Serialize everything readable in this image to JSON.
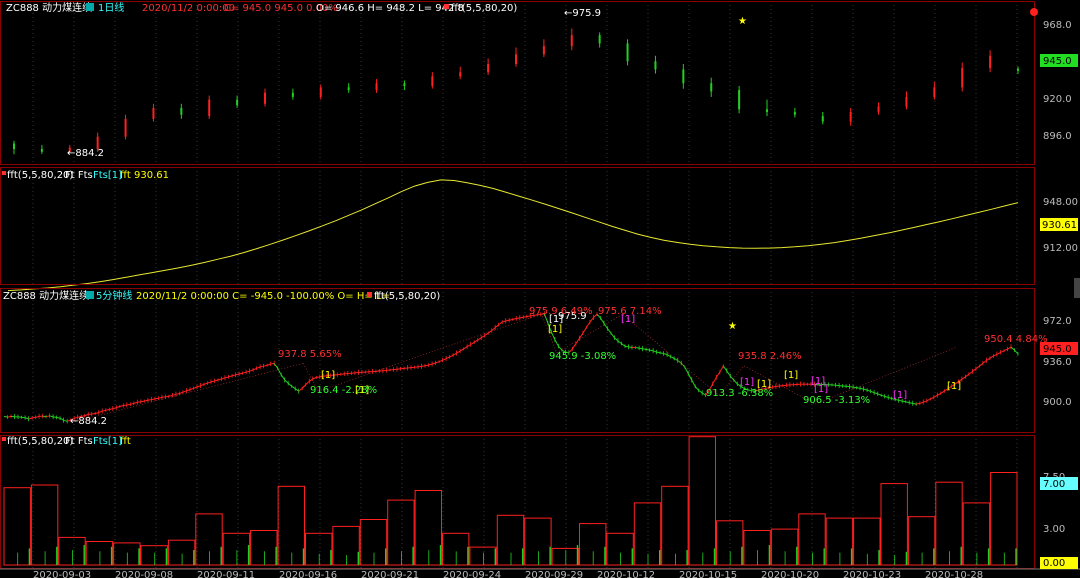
{
  "colors": {
    "background": "#000000",
    "panel_border": "#8b0000",
    "grid": "#555555",
    "up": "#ff2020",
    "down": "#22d022",
    "ma_line": "#e8e830",
    "price_box": "#22dd22",
    "price_box_red": "#ff2020",
    "fft_box": "#66ffff",
    "zero_box": "#ffff00",
    "label_white": "#ffffff",
    "label_green": "#33ff33",
    "label_red": "#ff3030",
    "label_yellow": "#ffff00",
    "label_magenta": "#ff33ff",
    "header_cyan": "#33ffff"
  },
  "panel1": {
    "symbol": "ZC888 动力煤连续",
    "period": "1日线",
    "datetime": "2020/11/2 0:00:00",
    "quote": "C= 945.0  945.0  0.00%",
    "ohlc": "O= 946.6  H= 948.2  L= 942.8",
    "indicator": "fft(5,5,80,20)",
    "hi_label": "←975.9",
    "lo_label": "←884.2",
    "price_tag": "945.0",
    "yticks": [
      "968.0",
      "920.0",
      "896.0"
    ],
    "star_icon": "★"
  },
  "panel2": {
    "title": "fft(5,5,80,20)",
    "items": "Ft Fts",
    "fts": "Fts[1]",
    "fft_value": "fft 930.61",
    "value_tag": "930.61",
    "yticks": [
      "948.00",
      "912.00"
    ]
  },
  "panel3": {
    "symbol": "ZC888 动力煤连续",
    "period": "5分钟线",
    "quote": "2020/11/2 0:00:00 C=  -945.0 -100.00% O= H= L=",
    "indicator": "fft(5,5,80,20)",
    "hi_label": "975.9",
    "lo_label": "←884.2",
    "price_tag": "945.0",
    "yticks": [
      "972.0",
      "936.0",
      "900.0"
    ],
    "star_icon": "★",
    "annotations_red": [
      "975.9 6.49%",
      "975.6 7.14%",
      "937.8 5.65%",
      "935.8 2.46%",
      "950.4 4.84%"
    ],
    "annotations_green": [
      "945.9 -3.08%",
      "916.4 -2.28%",
      "913.3 -6.38%",
      "906.5 -3.13%"
    ],
    "markers": [
      "[1]",
      "[1]",
      "[1]",
      "[1]",
      "[1]",
      "[1]",
      "[1]",
      "[1]",
      "[1]",
      "[1]",
      "[1]",
      "[1]"
    ]
  },
  "panel4": {
    "title": "fft(5,5,80,20)",
    "items": "Ft Fts",
    "fts": "Fts[1]",
    "fft_label": "fft",
    "value_tag": "7.00",
    "zero_tag": "0.00",
    "yticks": [
      "7.50",
      "3.00"
    ]
  },
  "x_axis": {
    "dates": [
      "2020-09-03",
      "2020-09-08",
      "2020-09-11",
      "2020-09-16",
      "2020-09-21",
      "2020-09-24",
      "2020-09-29",
      "2020-10-12",
      "2020-10-15",
      "2020-10-20",
      "2020-10-23",
      "2020-10-28"
    ]
  },
  "chart_data": [
    {
      "type": "candlestick",
      "title": "ZC888 动力煤连续 1日线",
      "ylim": [
        880,
        985
      ],
      "x": [
        "2020-09-03",
        "2020-09-04",
        "2020-09-07",
        "2020-09-08",
        "2020-09-09",
        "2020-09-10",
        "2020-09-11",
        "2020-09-14",
        "2020-09-15",
        "2020-09-16",
        "2020-09-17",
        "2020-09-18",
        "2020-09-21",
        "2020-09-22",
        "2020-09-23",
        "2020-09-24",
        "2020-09-25",
        "2020-09-28",
        "2020-09-29",
        "2020-09-30",
        "2020-10-09",
        "2020-10-12",
        "2020-10-13",
        "2020-10-14",
        "2020-10-15",
        "2020-10-16",
        "2020-10-19",
        "2020-10-20",
        "2020-10-21",
        "2020-10-22",
        "2020-10-23",
        "2020-10-26",
        "2020-10-27",
        "2020-10-28",
        "2020-10-29",
        "2020-10-30",
        "2020-11-02"
      ],
      "open": [
        892,
        888,
        886,
        888,
        897,
        910,
        918,
        912,
        924,
        921,
        929,
        926,
        933,
        931,
        936,
        934,
        941,
        944,
        950,
        957,
        963,
        971,
        965,
        952,
        946,
        936,
        931,
        917,
        915,
        912,
        908,
        915,
        919,
        926,
        933,
        947,
        946.6
      ],
      "close": [
        888,
        886,
        889,
        897,
        910,
        918,
        913,
        924,
        920,
        929,
        926,
        933,
        931,
        936,
        934,
        941,
        944,
        950,
        957,
        963,
        971,
        965,
        952,
        946,
        936,
        930,
        917,
        915,
        913,
        908,
        915,
        919,
        926,
        933,
        947,
        956,
        945.0
      ],
      "high": [
        894,
        891,
        891,
        900,
        913,
        921,
        921,
        927,
        927,
        932,
        932,
        935,
        936,
        939,
        938,
        944,
        948,
        954,
        962,
        968,
        975.9,
        973,
        968,
        956,
        950,
        940,
        934,
        924,
        918,
        915,
        918,
        922,
        930,
        937,
        951,
        960,
        948.2
      ],
      "low": [
        884.2,
        884.5,
        885,
        886,
        895,
        908,
        910,
        910,
        918,
        919,
        924,
        924,
        929,
        929,
        931,
        932,
        939,
        942,
        948,
        955,
        960,
        962,
        949,
        943,
        932,
        926,
        914,
        912,
        911,
        906,
        905,
        913,
        917,
        924,
        930,
        944,
        942.8
      ]
    },
    {
      "type": "line",
      "title": "fft(5,5,80,20)",
      "ylim": [
        895,
        965
      ],
      "series": [
        {
          "name": "fft",
          "values": [
            889.5,
            890,
            890.6,
            891.2,
            892,
            893,
            894,
            895.2,
            896.5,
            898,
            899.5,
            901,
            902.5,
            904,
            905.7,
            907.5,
            909.5,
            911.5,
            913.8,
            916.3,
            919,
            921.8,
            924.7,
            927.7,
            930.8,
            934,
            937.5,
            941,
            944.8,
            948.6,
            952.5,
            956,
            958.4,
            960,
            959.6,
            958.2,
            956.5,
            954.5,
            952,
            949.5,
            947,
            944.4,
            941.7,
            939,
            936.2,
            933.4,
            930.6,
            928,
            925.5,
            923.4,
            921.6,
            920.2,
            919,
            918.1,
            917.4,
            916.9,
            916.6,
            916.5,
            916.6,
            916.9,
            917.4,
            918.1,
            919,
            920.1,
            921.4,
            922.8,
            924.4,
            926,
            927.8,
            929.6,
            931.5,
            933.4,
            935.3,
            937.3,
            939.3,
            941.3,
            943.4,
            945.5
          ]
        }
      ]
    },
    {
      "type": "line",
      "title": "ZC888 动力煤连续 5分钟线",
      "ylim": [
        885,
        985
      ],
      "series": [
        {
          "name": "ZC888",
          "values": [
            897,
            896.5,
            897,
            896.8,
            896.6,
            896.4,
            896,
            895,
            895.8,
            896.3,
            897,
            897.2,
            896.8,
            897.5,
            896.6,
            896.2,
            895.6,
            894,
            893.2,
            894.2,
            895.5,
            896.3,
            897,
            897.5,
            898.5,
            898.8,
            899.2,
            900,
            901,
            901.8,
            902.3,
            903,
            903.7,
            904.7,
            905.3,
            905.8,
            906.3,
            907,
            907.8,
            908.3,
            908.8,
            909.4,
            909.9,
            910.5,
            911,
            911.7,
            912,
            912.5,
            913.2,
            914,
            914.6,
            915.6,
            916.6,
            917.6,
            918.6,
            919.6,
            920.6,
            921.6,
            922.6,
            923.5,
            924.2,
            925,
            925.8,
            926.6,
            927.4,
            928.2,
            928.9,
            929.6,
            930.3,
            931,
            931.8,
            932.8,
            934,
            935,
            935.6,
            936.3,
            937.3,
            937.8,
            934,
            929,
            925,
            922.5,
            920.2,
            918.3,
            916.4,
            918.5,
            921.5,
            924,
            925.9,
            927,
            927.4,
            927.9,
            928.3,
            928.6,
            928.8,
            929.1,
            929.4,
            929.7,
            930,
            930.2,
            930.5,
            930.8,
            930.9,
            931.1,
            931.3,
            931.5,
            931.6,
            931.9,
            932.1,
            932.4,
            932.7,
            933,
            933.3,
            933.6,
            933.9,
            934.2,
            934.5,
            934.8,
            935.1,
            935.4,
            935.9,
            936.5,
            937.2,
            938.1,
            939.1,
            940.2,
            941.4,
            942.7,
            944.1,
            945.6,
            947.2,
            948.9,
            950.6,
            952.3,
            954,
            955.7,
            957.4,
            959.2,
            961,
            963,
            965.3,
            967.6,
            969.5,
            970.5,
            971,
            971.6,
            972.3,
            972.8,
            973.3,
            973.8,
            974.3,
            974.7,
            975.1,
            975.5,
            975.9,
            969,
            962,
            956,
            951,
            948,
            946.5,
            945.9,
            949,
            953,
            957,
            961,
            965.5,
            969.5,
            973,
            975.6,
            972.7,
            968.5,
            964.5,
            961,
            957.5,
            955,
            953,
            951,
            950.5,
            950,
            950,
            949.5,
            949,
            948.5,
            948,
            947.5,
            946.5,
            946,
            945.3,
            944.5,
            943,
            941.5,
            940,
            938,
            935,
            930,
            925,
            920,
            917,
            915,
            913.3,
            917,
            922,
            927,
            931,
            935.8,
            932,
            928,
            925,
            922,
            920,
            918.5,
            917.5,
            916.8,
            916.5,
            917.2,
            917.8,
            918.5,
            919,
            919.5,
            920,
            920.4,
            920.7,
            921,
            921.2,
            921.4,
            921.6,
            921.8,
            921.8,
            921.8,
            921.8,
            921.8,
            921.7,
            921.6,
            921.5,
            921.4,
            921.2,
            921,
            920.7,
            920.4,
            920.2,
            919.9,
            919.5,
            919.1,
            918.6,
            918,
            917.2,
            916.3,
            915.3,
            914.3,
            913.3,
            912.4,
            911.6,
            910.8,
            910.1,
            909.4,
            908.8,
            908.2,
            907.6,
            907,
            906.5,
            907,
            908,
            909,
            910.3,
            911.7,
            913.2,
            914.8,
            916.5,
            918.2,
            920,
            921.8,
            923.7,
            925.6,
            927.5,
            929.5,
            931.5,
            933.6,
            935.7,
            937.9,
            940,
            941.8,
            943.4,
            944.8,
            946.2,
            947.5,
            948.8,
            950.4,
            948,
            945
          ]
        }
      ]
    },
    {
      "type": "bar",
      "title": "fft(5,5,80,20)",
      "ylim": [
        0,
        10
      ],
      "categories": [
        "1",
        "2",
        "3",
        "4",
        "5",
        "6",
        "7",
        "8",
        "9",
        "10",
        "11",
        "12",
        "13",
        "14",
        "15",
        "16",
        "17",
        "18",
        "19",
        "20",
        "21",
        "22",
        "23",
        "24",
        "25",
        "26",
        "27",
        "28",
        "29",
        "30",
        "31",
        "32",
        "33",
        "34",
        "35",
        "36",
        "37"
      ],
      "values": [
        5.6,
        5.8,
        2.0,
        1.7,
        1.6,
        1.4,
        1.8,
        3.7,
        2.3,
        2.5,
        5.7,
        2.3,
        2.8,
        3.3,
        4.7,
        5.4,
        2.3,
        1.3,
        3.6,
        3.4,
        1.2,
        3.0,
        2.3,
        4.5,
        5.7,
        9.3,
        3.2,
        2.5,
        2.6,
        3.7,
        3.4,
        3.4,
        5.9,
        3.5,
        6.0,
        4.5,
        6.7
      ],
      "series": [
        {
          "name": "Ft",
          "values": [
            5.6,
            5.8,
            2.0,
            1.7,
            1.6,
            1.4,
            1.8,
            3.7,
            2.3,
            2.5,
            5.7,
            2.3,
            2.8,
            3.3,
            4.7,
            5.4,
            2.3,
            1.3,
            3.6,
            3.4,
            1.2,
            3.0,
            2.3,
            4.5,
            5.7,
            9.3,
            3.2,
            2.5,
            2.6,
            3.7,
            3.4,
            3.4,
            5.9,
            3.5,
            6.0,
            4.5,
            6.7
          ]
        },
        {
          "name": "Fts",
          "values": [
            1.0,
            1.1,
            1.2,
            1.1,
            1.0,
            1.0,
            0.9,
            1.1,
            1.2,
            1.1,
            1.0,
            0.9,
            0.8,
            1.0,
            1.1,
            1.2,
            1.1,
            1.0,
            1.0,
            1.1,
            1.2,
            1.1,
            1.0,
            0.9,
            0.9,
            1.0,
            1.1,
            1.2,
            1.1,
            1.0,
            1.0,
            0.9,
            0.8,
            1.0,
            1.1,
            1.0,
            1.0
          ]
        }
      ]
    }
  ]
}
